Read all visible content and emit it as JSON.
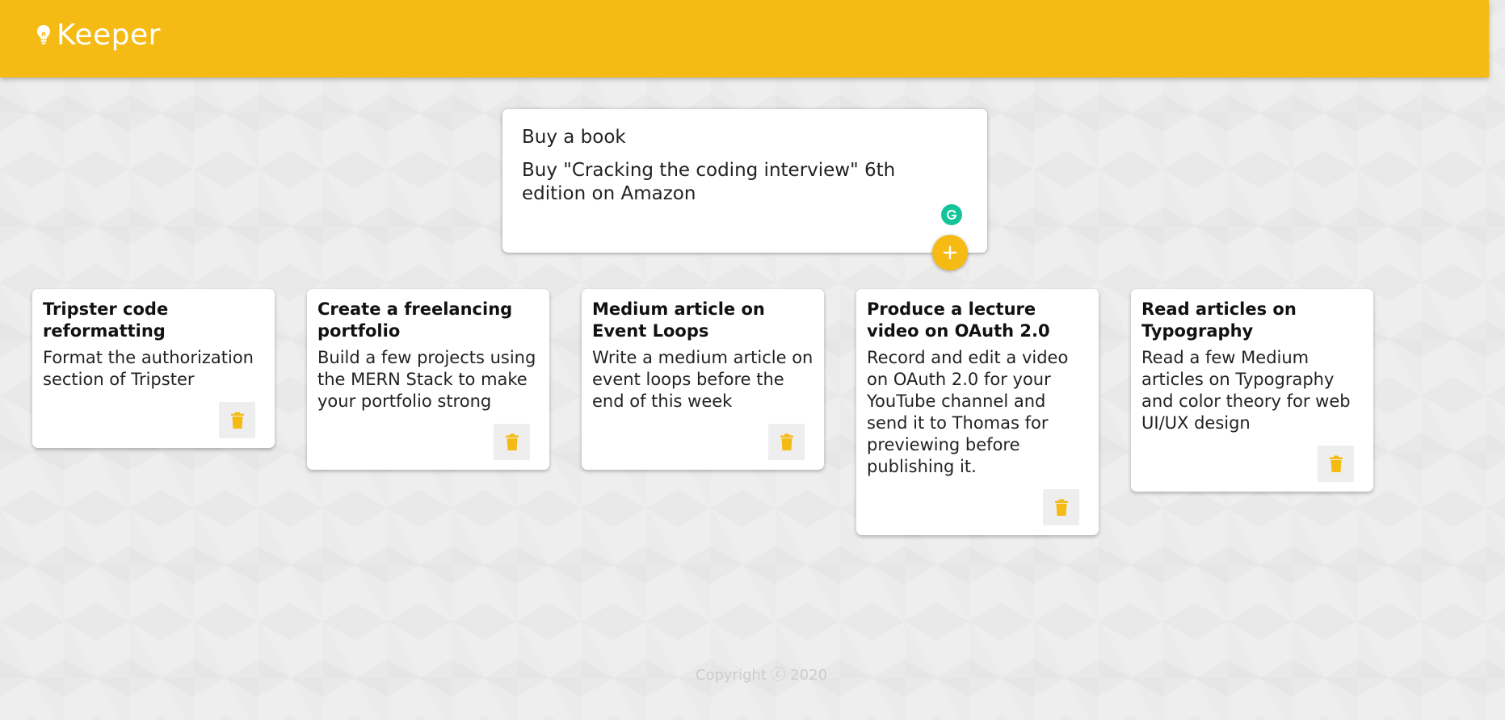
{
  "header": {
    "brand_icon": "lightbulb-icon",
    "title": "Keeper",
    "color": "#f5ba13"
  },
  "create_note": {
    "title_value": "Buy a book",
    "content_value": "Buy \"Cracking the coding interview\" 6th edition on Amazon",
    "grammarly_icon": "grammarly-icon",
    "add_icon": "plus-icon"
  },
  "notes": [
    {
      "title": "Tripster code reformatting",
      "content": "Format the authorization section of Tripster",
      "delete_icon": "trash-icon"
    },
    {
      "title": "Create a freelancing portfolio",
      "content": "Build a few projects using the MERN Stack to make your portfolio strong",
      "delete_icon": "trash-icon"
    },
    {
      "title": "Medium article on Event Loops",
      "content": "Write a medium article on event loops before the end of this week",
      "delete_icon": "trash-icon"
    },
    {
      "title": "Produce a lecture video on OAuth 2.0",
      "content": "Record and edit a video on OAuth 2.0 for your YouTube channel and send it to Thomas for previewing before publishing it.",
      "delete_icon": "trash-icon"
    },
    {
      "title": "Read articles on Typography",
      "content": "Read a few Medium articles on Typography and color theory for web UI/UX design",
      "delete_icon": "trash-icon"
    }
  ],
  "footer": {
    "copyright": "Copyright ⓒ 2020"
  }
}
